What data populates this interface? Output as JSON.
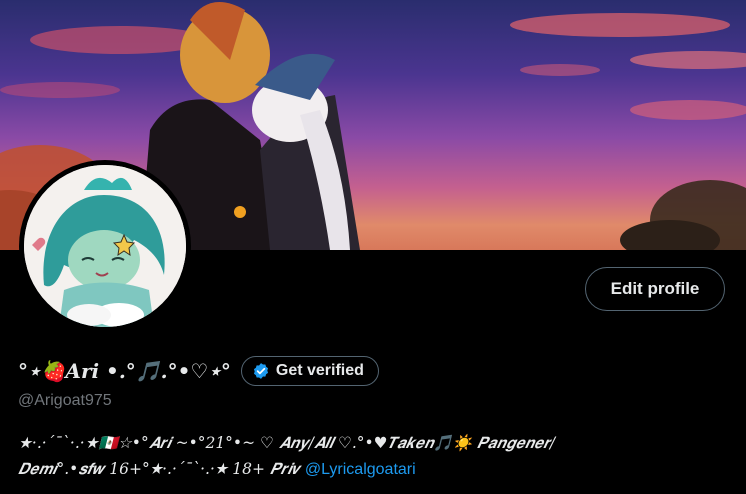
{
  "profile": {
    "display_name": "°⋆🍓𝑨𝒓𝒊 •.°🎵.°•♡⋆°",
    "handle": "@Arigoat975",
    "bio_line1": "★·.·´¯`·.·★🇲🇽☆•°𝑨𝒓𝒊 ~•°21°•~ ♡ 𝑨𝒏𝒚/𝑨𝒍𝒍 ♡.°•♥𝑻𝒂𝒌𝒆𝒏🎵☀️ 𝑷𝒂𝒏𝒈𝒆𝒏𝒆𝒓/",
    "bio_line2": "𝑫𝒆𝒎𝒊°.•𝒔𝒇𝒘 16+°★·.·´¯`·.·★ 18+ 𝑷𝒓𝒊𝒗",
    "bio_link": "@Lyricalgoatari"
  },
  "buttons": {
    "edit_profile": "Edit profile",
    "get_verified": "Get verified"
  },
  "colors": {
    "background": "#000000",
    "text": "#e7e9ea",
    "muted": "#71767b",
    "link": "#1d9bf0",
    "border": "#536471",
    "verified_badge": "#1d9bf0"
  },
  "icons": {
    "verify": "verified-badge-icon"
  }
}
